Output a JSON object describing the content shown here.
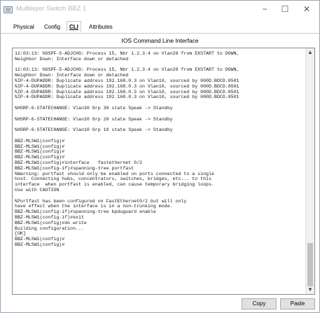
{
  "window": {
    "title": "Multilayer Switch BBZ 1",
    "controls": [
      "−",
      "☐",
      "✕"
    ]
  },
  "tabs": [
    {
      "label": "Physical",
      "active": false
    },
    {
      "label": "Config",
      "active": false
    },
    {
      "label": "CLI",
      "active": true
    },
    {
      "label": "Attributes",
      "active": false
    }
  ],
  "section_title": "IOS Command Line Interface",
  "console": {
    "lines": [
      "12:03:13: %OSPF-5-ADJCHG: Process 15, Nbr 1.2.3.4 on Vlan20 from EXSTART to DOWN,",
      "Neighbor Down: Interface down or detached",
      "",
      "12:03:13: %OSPF-5-ADJCHG: Process 15, Nbr 1.2.3.4 on Vlan20 from EXSTART to DOWN,",
      "Neighbor Down: Interface down or detached",
      "%IP-4-DUPADDR: Duplicate address 192.168.0.3 on Vlan10, sourced by 000D.BDCD.8501",
      "%IP-4-DUPADDR: Duplicate address 192.168.0.3 on Vlan10, sourced by 000D.BDCD.8501",
      "%IP-4-DUPADDR: Duplicate address 192.168.0.3 on Vlan10, sourced by 000D.BDCD.8501",
      "%IP-4-DUPADDR: Duplicate address 192.168.0.3 on Vlan10, sourced by 000D.BDCD.8501",
      "",
      "%HSRP-6-STATECHANGE: Vlan30 Grp 30 state Speak -> Standby",
      "",
      "%HSRP-6-STATECHANGE: Vlan20 Grp 20 state Speak -> Standby",
      "",
      "%HSRP-6-STATECHANGE: Vlan10 Grp 10 state Speak -> Standby",
      "",
      "BBZ-MLSW1(config)#",
      "BBZ-MLSW1(config)#",
      "BBZ-MLSW1(config)#",
      "BBZ-MLSW1(config)#",
      "BBZ-MLSW1(config)#interface   fastethernet 0/2",
      "BBZ-MLSW1(config-if)#spanning-tree portfast",
      "%Warning: portfast should only be enabled on ports connected to a single",
      "host. Connecting hubs, concentrators, switches, bridges, etc... to this",
      "interface  when portfast is enabled, can cause temporary bridging loops.",
      "Use with CAUTION",
      "",
      "%Portfast has been configured on FastEthernet0/2 but will only",
      "have effect when the interface is in a non-trunking mode.",
      "BBZ-MLSW1(config-if)#spanning-tree bpduguard enable",
      "BBZ-MLSW1(config-if)#exit",
      "BBZ-MLSW1(config)#do write",
      "Building configuration...",
      "[OK]",
      "BBZ-MLSW1(config)#",
      "BBZ-MLSW1(config)#"
    ]
  },
  "buttons": {
    "copy": "Copy",
    "paste": "Paste"
  }
}
